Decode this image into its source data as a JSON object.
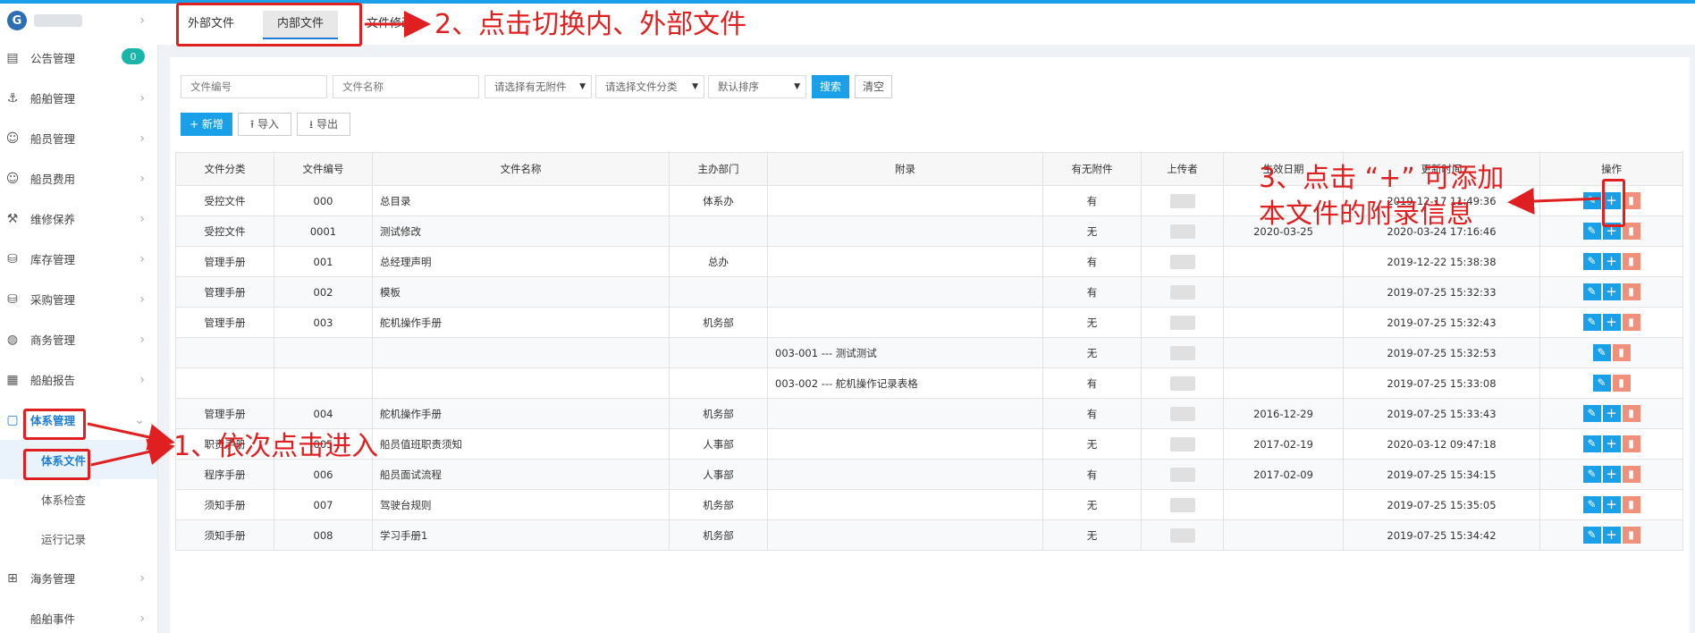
{
  "colors": {
    "accent": "#1aa0e8",
    "annotation": "#e02020",
    "badge": "#19b5a8",
    "delete": "#f0907a"
  },
  "sidebar": {
    "logo_text": "G",
    "items": [
      {
        "label": "公告管理",
        "icon": "book-icon",
        "badge": "0"
      },
      {
        "label": "船舶管理",
        "icon": "anchor-icon"
      },
      {
        "label": "船员管理",
        "icon": "user-icon"
      },
      {
        "label": "船员费用",
        "icon": "user-icon"
      },
      {
        "label": "维修保养",
        "icon": "wrench-icon"
      },
      {
        "label": "库存管理",
        "icon": "bag-icon"
      },
      {
        "label": "采购管理",
        "icon": "bag-icon"
      },
      {
        "label": "商务管理",
        "icon": "globe-icon"
      },
      {
        "label": "船舶报告",
        "icon": "calendar-icon"
      },
      {
        "label": "体系管理",
        "icon": "file-icon"
      }
    ],
    "sub_items": [
      "体系文件",
      "体系检查",
      "运行记录"
    ],
    "items_after": [
      {
        "label": "海务管理",
        "icon": "sitemap-icon"
      },
      {
        "label": "船舶事件",
        "icon": ""
      }
    ]
  },
  "tabs": [
    "外部文件",
    "内部文件",
    "文件修改"
  ],
  "filters": {
    "file_no_placeholder": "文件编号",
    "file_name_placeholder": "文件名称",
    "attachment_select": "请选择有无附件",
    "category_select": "请选择文件分类",
    "sort_select": "默认排序",
    "search": "搜索",
    "clear": "清空"
  },
  "toolbar": {
    "add": "+ 新增",
    "import": "导入",
    "export": "导出"
  },
  "table": {
    "headers": [
      "文件分类",
      "文件编号",
      "文件名称",
      "主办部门",
      "附录",
      "有无附件",
      "上传者",
      "生效日期",
      "更新时间",
      "操作"
    ],
    "rows": [
      {
        "cat": "受控文件",
        "no": "000",
        "name": "总目录",
        "dept": "体系办",
        "appendix": "",
        "att": "有",
        "eff": "",
        "upd": "2019-12-17 11:49:36",
        "add": true
      },
      {
        "cat": "受控文件",
        "no": "0001",
        "name": "测试修改",
        "dept": "",
        "appendix": "",
        "att": "无",
        "eff": "2020-03-25",
        "upd": "2020-03-24 17:16:46",
        "add": true
      },
      {
        "cat": "管理手册",
        "no": "001",
        "name": "总经理声明",
        "dept": "总办",
        "appendix": "",
        "att": "有",
        "eff": "",
        "upd": "2019-12-22 15:38:38",
        "add": true
      },
      {
        "cat": "管理手册",
        "no": "002",
        "name": "模板",
        "dept": "",
        "appendix": "",
        "att": "有",
        "eff": "",
        "upd": "2019-07-25 15:32:33",
        "add": true
      },
      {
        "cat": "管理手册",
        "no": "003",
        "name": "舵机操作手册",
        "dept": "机务部",
        "appendix": "",
        "att": "无",
        "eff": "",
        "upd": "2019-07-25 15:32:43",
        "add": true
      },
      {
        "cat": "",
        "no": "",
        "name": "",
        "dept": "",
        "appendix": "003-001  ---  测试测试",
        "att": "无",
        "eff": "",
        "upd": "2019-07-25 15:32:53",
        "add": false
      },
      {
        "cat": "",
        "no": "",
        "name": "",
        "dept": "",
        "appendix": "003-002  ---  舵机操作记录表格",
        "att": "有",
        "eff": "",
        "upd": "2019-07-25 15:33:08",
        "add": false
      },
      {
        "cat": "管理手册",
        "no": "004",
        "name": "舵机操作手册",
        "dept": "机务部",
        "appendix": "",
        "att": "有",
        "eff": "2016-12-29",
        "upd": "2019-07-25 15:33:43",
        "add": true
      },
      {
        "cat": "职责手册",
        "no": "005",
        "name": "船员值班职责须知",
        "dept": "人事部",
        "appendix": "",
        "att": "无",
        "eff": "2017-02-19",
        "upd": "2020-03-12 09:47:18",
        "add": true
      },
      {
        "cat": "程序手册",
        "no": "006",
        "name": "船员面试流程",
        "dept": "人事部",
        "appendix": "",
        "att": "有",
        "eff": "2017-02-09",
        "upd": "2019-07-25 15:34:15",
        "add": true
      },
      {
        "cat": "须知手册",
        "no": "007",
        "name": "驾驶台规则",
        "dept": "机务部",
        "appendix": "",
        "att": "无",
        "eff": "",
        "upd": "2019-07-25 15:35:05",
        "add": true
      },
      {
        "cat": "须知手册",
        "no": "008",
        "name": "学习手册1",
        "dept": "机务部",
        "appendix": "",
        "att": "无",
        "eff": "",
        "upd": "2019-07-25 15:34:42",
        "add": true
      }
    ]
  },
  "annotations": {
    "step1": "1、依次点击进入",
    "step2": "2、点击切换内、外部文件",
    "step3_line1": "3、点击 “+” 可添加",
    "step3_line2": "本文件的附录信息"
  }
}
